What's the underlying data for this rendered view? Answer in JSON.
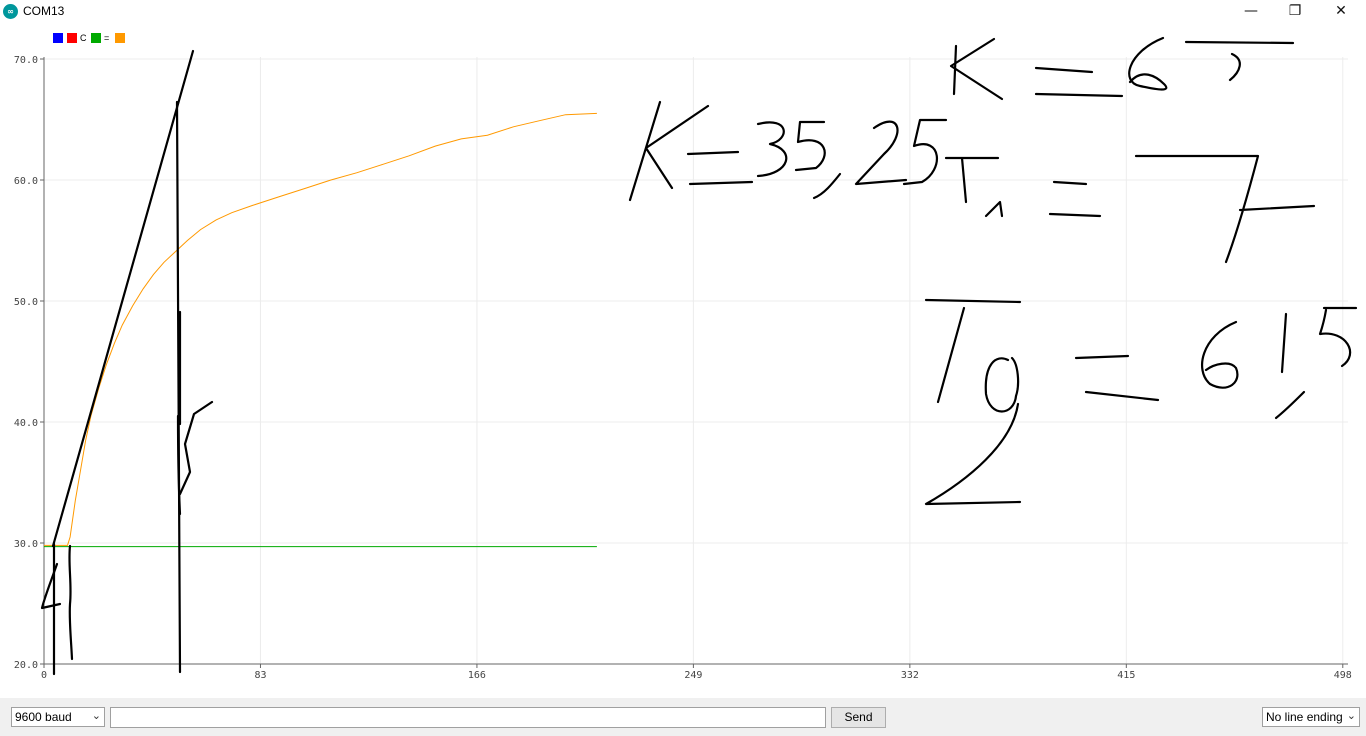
{
  "window": {
    "title": "COM13",
    "icon_text": "∞",
    "minimize": "—",
    "maximize": "❐",
    "close": "✕"
  },
  "legend": [
    {
      "color": "#0000ff",
      "label": ""
    },
    {
      "color": "#ff0000",
      "label": "C"
    },
    {
      "color": "#00aa00",
      "label": "="
    },
    {
      "color": "#ff9900",
      "label": ""
    }
  ],
  "chart_data": {
    "type": "line",
    "xlim": [
      0,
      500
    ],
    "ylim": [
      20.0,
      70.0
    ],
    "x_ticks": [
      "0",
      "83",
      "166",
      "249",
      "332",
      "415",
      "498"
    ],
    "y_ticks": [
      "70.0",
      "60.0",
      "50.0",
      "40.0",
      "30.0",
      "20.0"
    ],
    "series": [
      {
        "color": "#00aa00",
        "x": [
          0,
          212
        ],
        "y": [
          29.7,
          29.7
        ]
      },
      {
        "color": "#ff9900",
        "x": [
          0,
          9,
          10,
          11,
          12,
          14,
          16,
          18,
          21,
          24,
          27,
          30,
          34,
          38,
          42,
          46,
          50,
          55,
          60,
          66,
          72,
          80,
          90,
          100,
          110,
          120,
          130,
          140,
          150,
          160,
          170,
          180,
          190,
          200,
          212
        ],
        "y": [
          29.8,
          29.8,
          30.5,
          32.0,
          33.5,
          36.0,
          38.5,
          40.5,
          42.8,
          44.8,
          46.5,
          48.0,
          49.6,
          51.0,
          52.2,
          53.2,
          54.0,
          55.0,
          55.9,
          56.7,
          57.3,
          57.9,
          58.6,
          59.3,
          60.0,
          60.6,
          61.3,
          62.0,
          62.8,
          63.4,
          63.7,
          64.4,
          64.9,
          65.4,
          65.5
        ]
      }
    ]
  },
  "controls": {
    "baud": "9600 baud",
    "send": "Send",
    "line_ending": "No line ending",
    "arrow": "⌄"
  }
}
